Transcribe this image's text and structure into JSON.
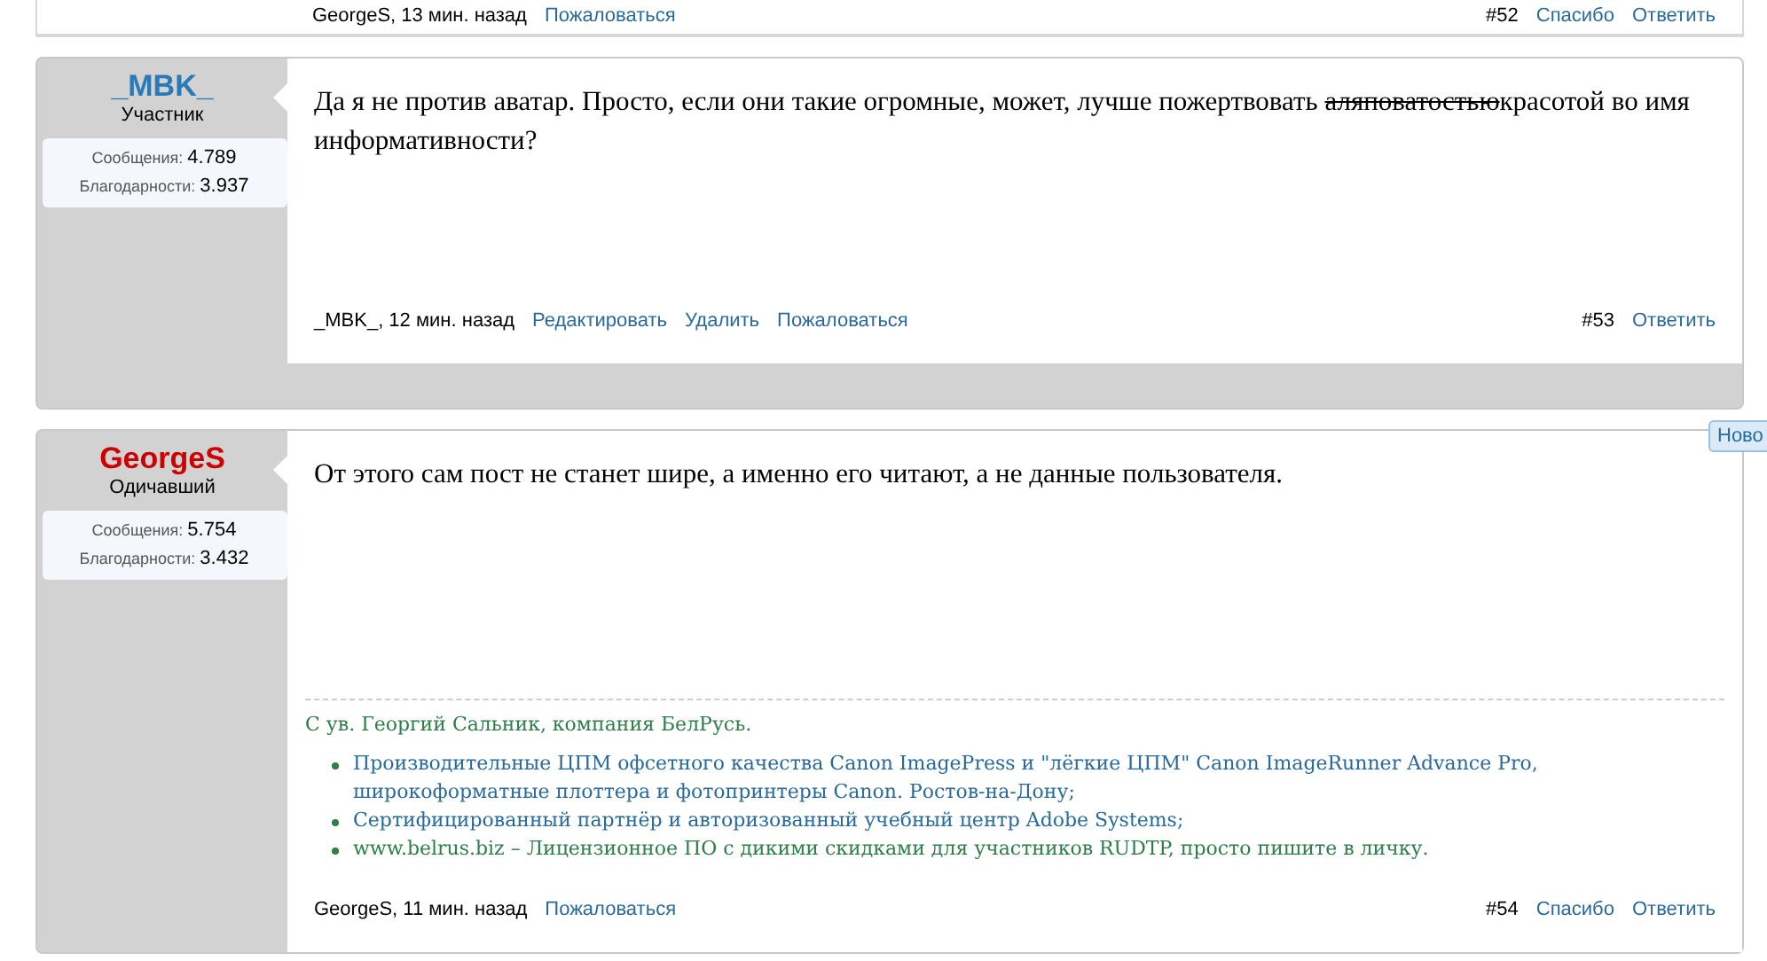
{
  "previous_post": {
    "footer": {
      "author_time": "GeorgeS, 13 мин. назад",
      "actions": [
        "Пожаловаться"
      ],
      "number": "#52",
      "right_actions": [
        "Спасибо",
        "Ответить"
      ]
    }
  },
  "posts": [
    {
      "author": {
        "name": "_MBK_",
        "color": "#2a7ab8",
        "role": "Участник"
      },
      "stats": [
        {
          "label": "Сообщения:",
          "value": "4.789"
        },
        {
          "label": "Благодарности:",
          "value": "3.937"
        }
      ],
      "body": [
        {
          "text": "Да я не против аватар. Просто, если они такие огромные, может, лучше пожертвовать ",
          "struck": false
        },
        {
          "text": "аляповатостью",
          "struck": true
        },
        {
          "text": "красотой во имя информативности?",
          "struck": false
        }
      ],
      "footer": {
        "author_time": "_MBK_, 12 мин. назад",
        "actions": [
          "Редактировать",
          "Удалить",
          "Пожаловаться"
        ],
        "number": "#53",
        "right_actions": [
          "Ответить"
        ]
      }
    },
    {
      "author": {
        "name": "GeorgeS",
        "color": "#cc0000",
        "role": "Одичавший"
      },
      "stats": [
        {
          "label": "Сообщения:",
          "value": "5.754"
        },
        {
          "label": "Благодарности:",
          "value": "3.432"
        }
      ],
      "body": [
        {
          "text": "От этого сам пост не станет шире, а именно его читают, а не данные пользователя.",
          "struck": false
        }
      ],
      "signature": {
        "title": "С ув. Георгий Сальник, компания БелРусь.",
        "items": [
          {
            "text": "Производительные ЦПМ офсетного качества Canon ImagePress и \"лёгкие ЦПМ\" Canon ImageRunner Advance Pro, широкоформатные плоттера и фотопринтеры Canon. Ростов-на-Дону;",
            "color": "#2a6a9a"
          },
          {
            "text": "Сертифицированный партнёр и авторизованный учебный центр Adobe Systems;",
            "color": "#2a6a9a"
          },
          {
            "text": "www.belrus.biz – Лицензионное ПО с дикими скидками для участников RUDTP, просто пишите в личку.",
            "color": "#2e7d4a"
          }
        ]
      },
      "footer": {
        "author_time": "GeorgeS, 11 мин. назад",
        "actions": [
          "Пожаловаться"
        ],
        "number": "#54",
        "right_actions": [
          "Спасибо",
          "Ответить"
        ]
      }
    }
  ],
  "new_tab": "Ново"
}
